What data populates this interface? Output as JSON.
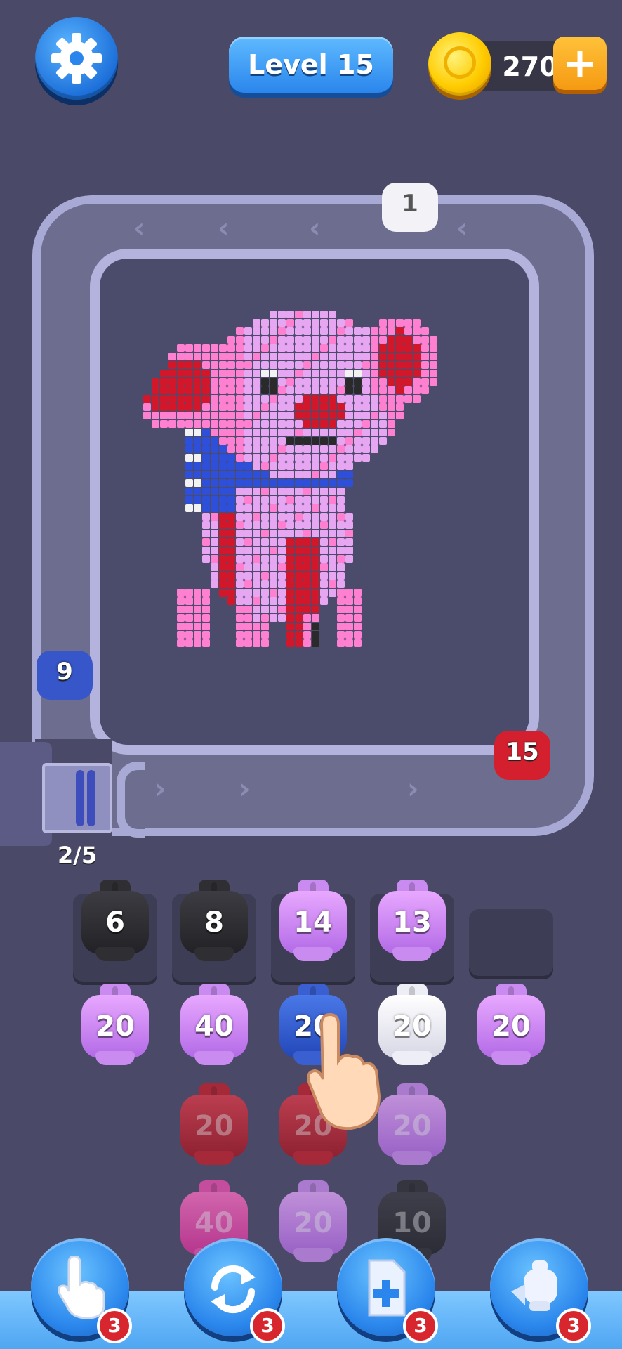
{
  "header": {
    "level_label": "Level 15",
    "coins": "270",
    "add_coins_glyph": "+",
    "settings_icon": "gear-icon"
  },
  "conveyor": {
    "capacity_label": "2/5",
    "pieces": [
      {
        "id": "top",
        "value": "1",
        "color": "#f2f2f7"
      },
      {
        "id": "left",
        "value": "9",
        "color": "#3656c9"
      },
      {
        "id": "right",
        "value": "15",
        "color": "#d4202e"
      }
    ]
  },
  "picture": {
    "subject": "pixel-pig",
    "palette": {
      "pink": "#ff7fd0",
      "lilac": "#e6a6f2",
      "red": "#d3172b",
      "blue": "#2d4fd9",
      "white": "#f2f2f2",
      "black": "#2a2a2a"
    }
  },
  "grid": {
    "rows": [
      [
        {
          "value": "6",
          "color": "black"
        },
        {
          "value": "8",
          "color": "black"
        },
        {
          "value": "14",
          "color": "pink"
        },
        {
          "value": "13",
          "color": "pink"
        },
        {
          "value": "",
          "color": "empty"
        }
      ],
      [
        {
          "value": "20",
          "color": "pink"
        },
        {
          "value": "40",
          "color": "pink"
        },
        {
          "value": "20",
          "color": "blue"
        },
        {
          "value": "20",
          "color": "white"
        },
        {
          "value": "20",
          "color": "pink"
        }
      ],
      [
        {
          "value": "20",
          "color": "red"
        },
        {
          "value": "20",
          "color": "red"
        },
        {
          "value": "20",
          "color": "pink"
        }
      ],
      [
        {
          "value": "40",
          "color": "magenta"
        },
        {
          "value": "20",
          "color": "pink"
        },
        {
          "value": "10",
          "color": "black"
        }
      ]
    ]
  },
  "boosters": [
    {
      "icon": "pointer-hand-icon",
      "count": "3"
    },
    {
      "icon": "shuffle-icon",
      "count": "3"
    },
    {
      "icon": "add-slot-icon",
      "count": "3"
    },
    {
      "icon": "ghost-pig-icon",
      "count": "3"
    }
  ],
  "colors": {
    "accent": "#2a86ec",
    "background": "#4a4a68",
    "badge": "#d8262f"
  }
}
